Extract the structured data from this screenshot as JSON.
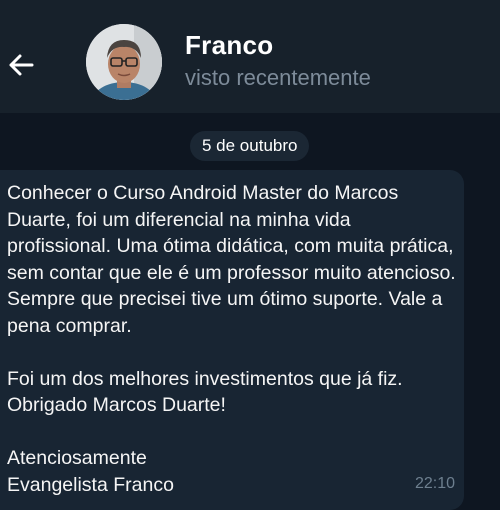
{
  "header": {
    "contact_name": "Franco",
    "contact_status": "visto recentemente"
  },
  "chat": {
    "date_separator": "5 de outubro",
    "message": {
      "text": "Conhecer o Curso Android Master do Marcos Duarte, foi um diferencial na minha vida profissional. Uma ótima didática, com muita prática, sem contar que ele é um professor muito atencioso. Sempre que precisei tive um ótimo suporte. Vale a pena comprar.\n\nFoi um dos melhores investimentos que já fiz. Obrigado Marcos Duarte!\n\nAtenciosamente\nEvangelista Franco",
      "time": "22:10"
    }
  },
  "icons": {
    "back": "back-arrow-icon"
  },
  "colors": {
    "header_bg": "#17212b",
    "chat_bg": "#0e1621",
    "bubble_bg": "#182533",
    "status_text": "#7d8b99"
  }
}
